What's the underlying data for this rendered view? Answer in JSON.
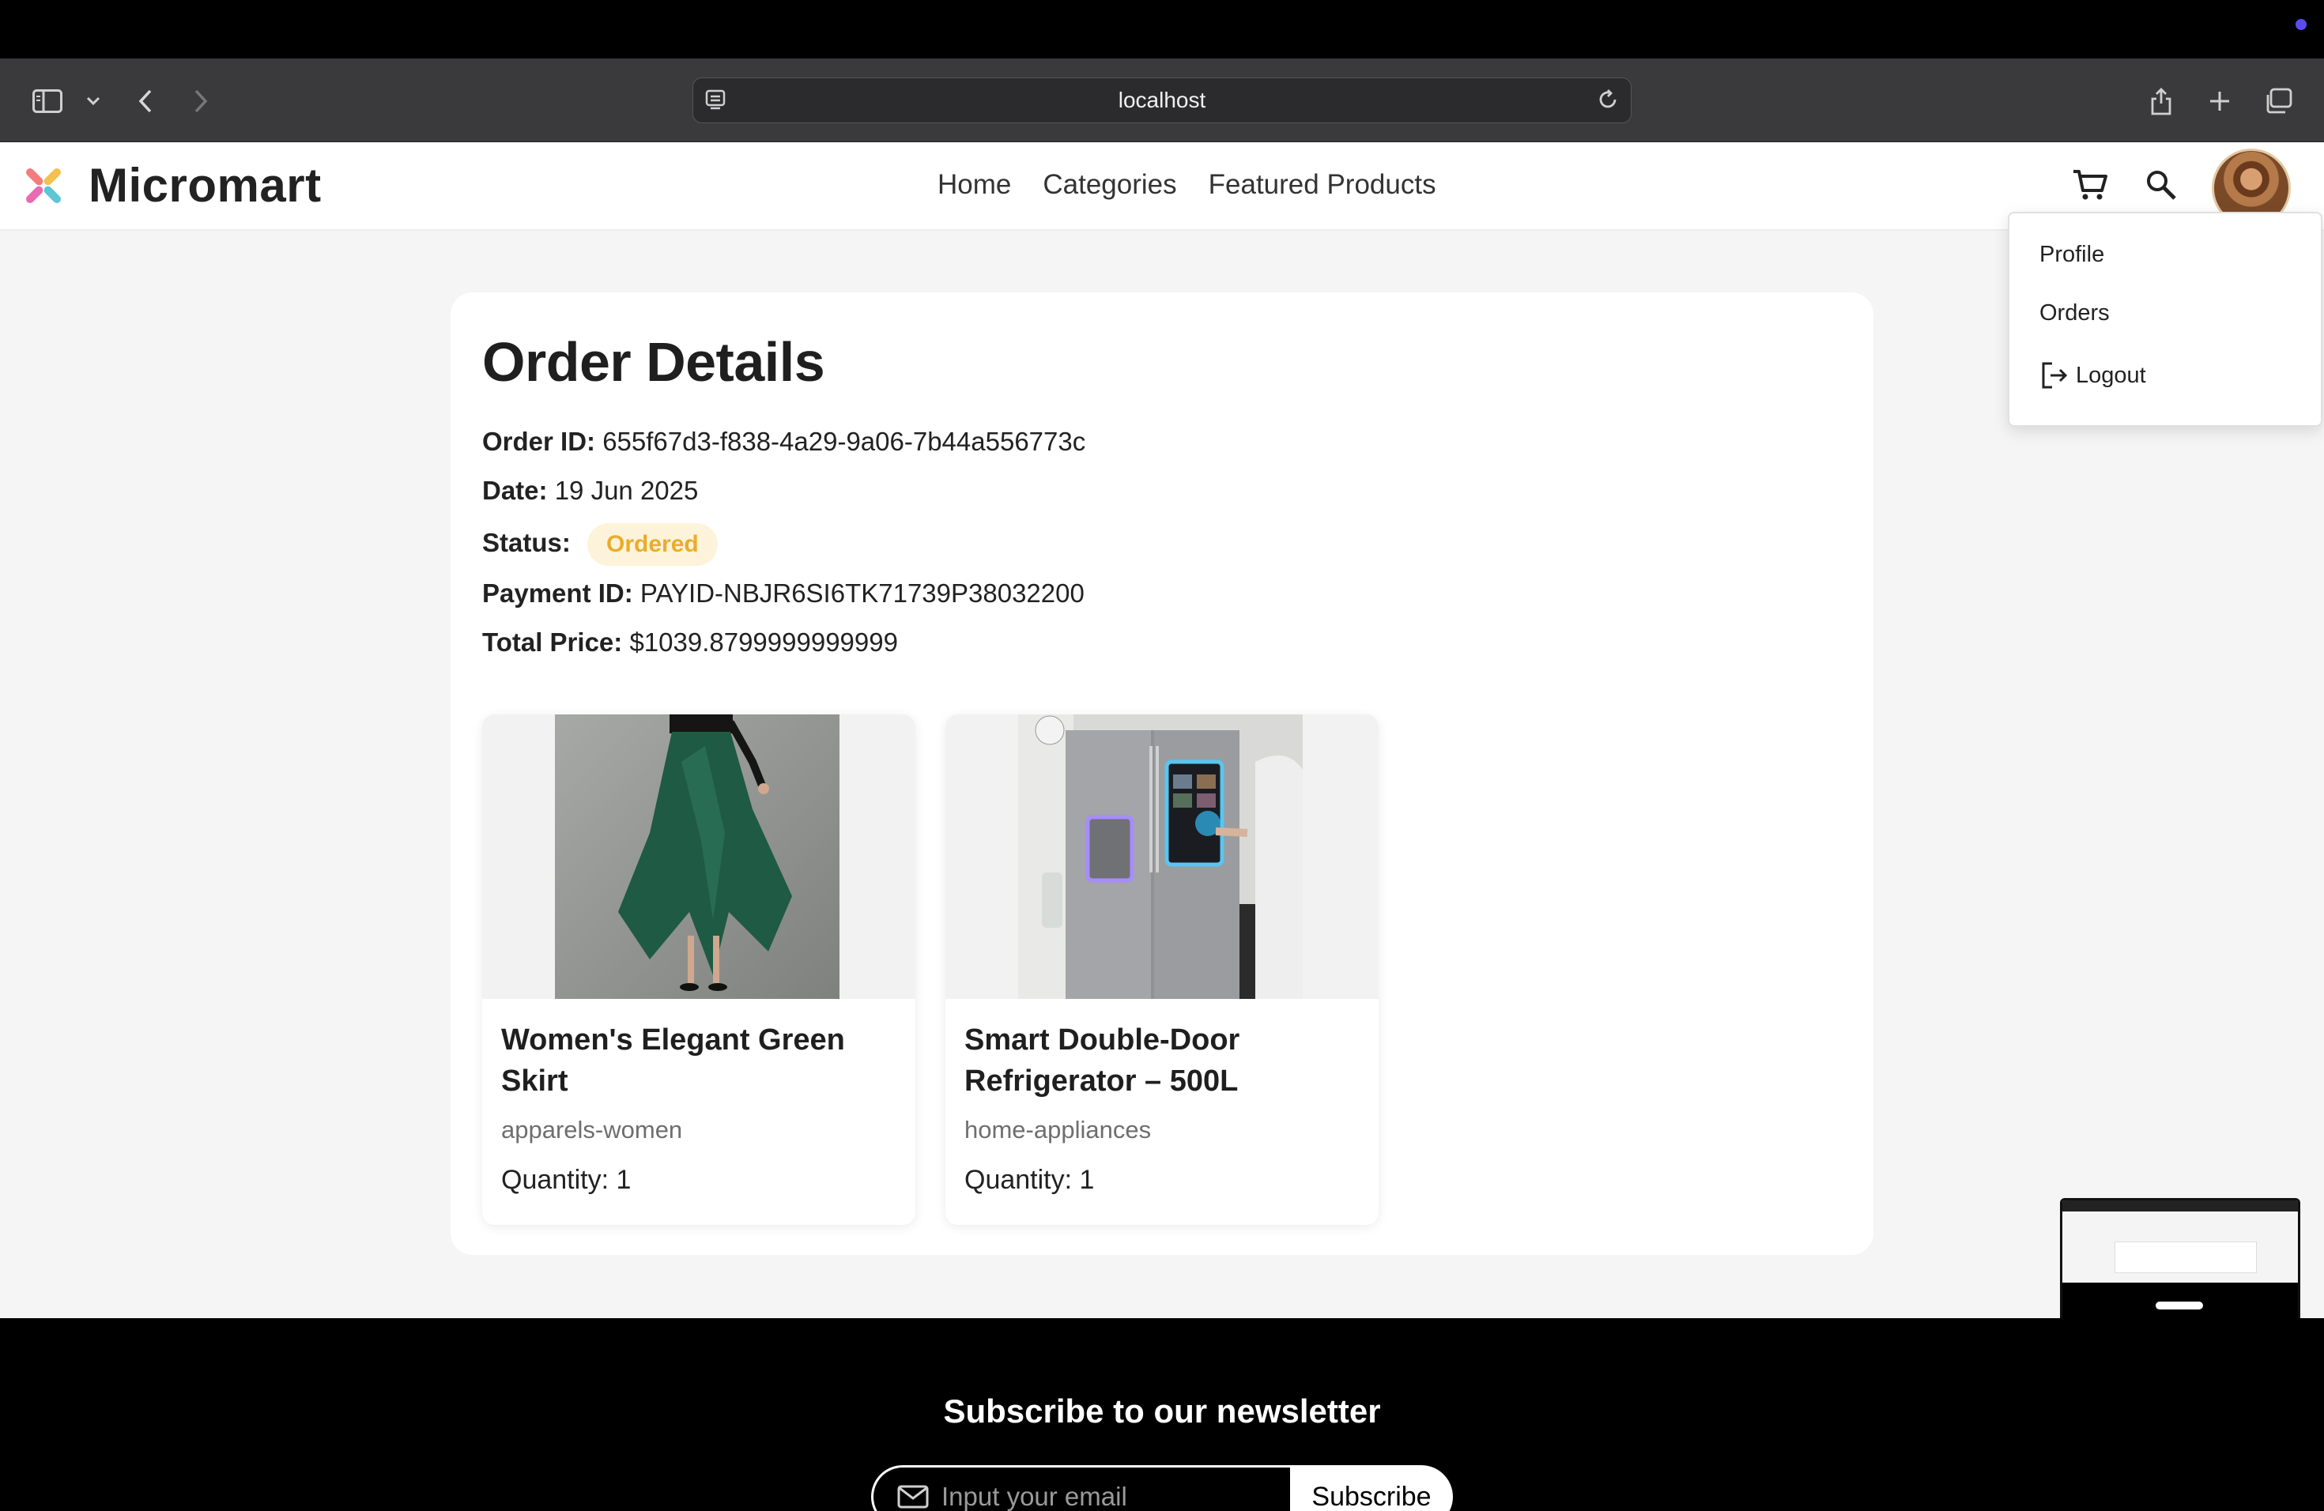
{
  "browser": {
    "url": "localhost"
  },
  "header": {
    "brand": "Micromart",
    "nav": [
      "Home",
      "Categories",
      "Featured Products"
    ]
  },
  "profile_menu": {
    "items": [
      "Profile",
      "Orders",
      "Logout"
    ]
  },
  "order": {
    "title": "Order Details",
    "order_id_label": "Order ID:",
    "order_id": "655f67d3-f838-4a29-9a06-7b44a556773c",
    "date_label": "Date:",
    "date": "19 Jun 2025",
    "status_label": "Status:",
    "status": "Ordered",
    "payment_label": "Payment ID:",
    "payment_id": "PAYID-NBJR6SI6TK71739P38032200",
    "total_label": "Total Price:",
    "total": "$1039.8799999999999",
    "status_color": "#e9ad2c"
  },
  "products": [
    {
      "name": "Women's Elegant Green Skirt",
      "category": "apparels-women",
      "quantity": "Quantity: 1"
    },
    {
      "name": "Smart Double-Door Refrigerator – 500L",
      "category": "home-appliances",
      "quantity": "Quantity: 1"
    }
  ],
  "footer": {
    "newsletter_title": "Subscribe to our newsletter",
    "email_placeholder": "Input your email",
    "subscribe_label": "Subscribe"
  }
}
